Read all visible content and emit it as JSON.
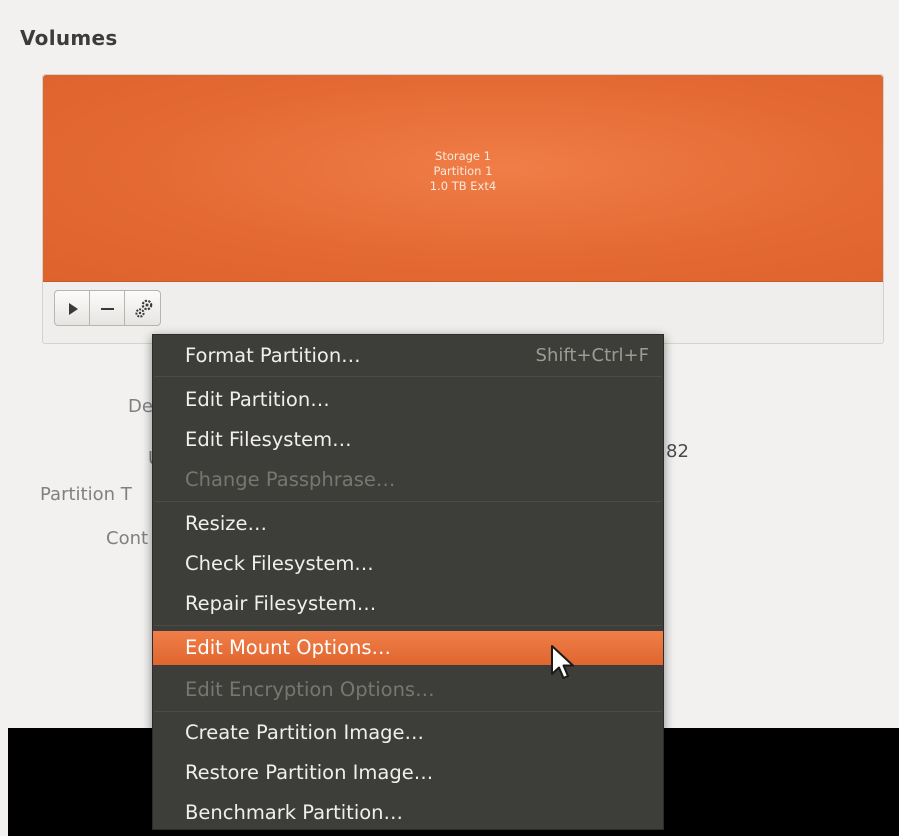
{
  "window": {
    "section_title": "Volumes"
  },
  "partition": {
    "name": "Storage 1",
    "label": "Partition 1",
    "size": "1.0 TB Ext4",
    "color": "#e86b34"
  },
  "toolbar": {
    "play_icon": "play-icon",
    "remove_icon": "minus-icon",
    "settings_icon": "gears-icon"
  },
  "details_behind": {
    "device_partial": "De",
    "uuid_partial": "U",
    "uuid_value_partial": "82",
    "partition_type_partial": "Partition T",
    "contents_partial": "Cont"
  },
  "menu": {
    "highlight_color": "#e8703a",
    "items": [
      {
        "label": "Format Partition…",
        "shortcut": "Shift+Ctrl+F",
        "enabled": true
      },
      {
        "label": "Edit Partition…",
        "enabled": true
      },
      {
        "label": "Edit Filesystem…",
        "enabled": true
      },
      {
        "label": "Change Passphrase…",
        "enabled": false
      },
      {
        "label": "Resize…",
        "enabled": true
      },
      {
        "label": "Check Filesystem…",
        "enabled": true
      },
      {
        "label": "Repair Filesystem…",
        "enabled": true
      },
      {
        "label": "Edit Mount Options…",
        "enabled": true,
        "highlighted": true
      },
      {
        "label": "Edit Encryption Options…",
        "enabled": false
      },
      {
        "label": "Create Partition Image…",
        "enabled": true
      },
      {
        "label": "Restore Partition Image…",
        "enabled": true
      },
      {
        "label": "Benchmark Partition…",
        "enabled": true
      }
    ]
  }
}
